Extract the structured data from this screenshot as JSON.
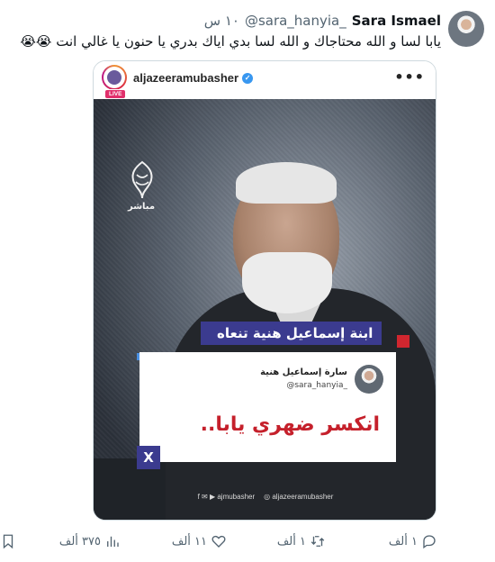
{
  "tweet": {
    "author_name": "Sara Ismael",
    "handle": "@sara_hanyia_",
    "time": "١٠ س",
    "text": "يابا لسا و الله محتاجاك و الله لسا بدي اياك بدري يا حنون يا غالي انت 😭😭"
  },
  "media": {
    "account": "aljazeeramubasher",
    "live_badge": "LIVE",
    "more": "•••",
    "logo_sub": "مباشر",
    "headline": "ابنة إسماعيل هنية تنعاه",
    "card": {
      "name": "سارة إسماعيل هنية",
      "handle": "@sara_hanyia_",
      "quote": "انكسر ضهري يابا.."
    },
    "x_mark": "X",
    "footer_left": "f ✉ ▶ ajmubasher",
    "footer_right": "◎ aljazeeramubasher"
  },
  "actions": {
    "reply_count": "١ ألف",
    "retweet_count": "١ ألف",
    "like_count": "١١ ألف",
    "views_count": "٣٧٥ ألف"
  }
}
